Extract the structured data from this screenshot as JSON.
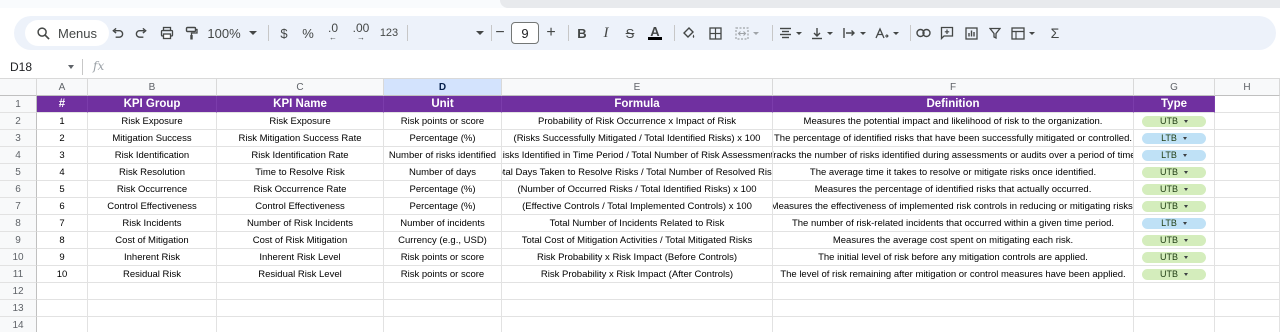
{
  "toolbar": {
    "menus_label": "Menus",
    "zoom": "100%",
    "currency": "$",
    "percent": "%",
    "dec_decrease": ".0",
    "dec_increase": ".00",
    "number_format": "123",
    "font_size": "9"
  },
  "formula_bar": {
    "cell_ref": "D18",
    "fx": "fx"
  },
  "sheet": {
    "columns": [
      "A",
      "B",
      "C",
      "D",
      "E",
      "F",
      "G",
      "H"
    ],
    "selected_column": "D",
    "row_numbers": [
      "1",
      "2",
      "3",
      "4",
      "5",
      "6",
      "7",
      "8",
      "9",
      "10",
      "11",
      "12",
      "13",
      "14"
    ],
    "header_row": [
      "#",
      "KPI Group",
      "KPI Name",
      "Unit",
      "Formula",
      "Definition",
      "Type"
    ],
    "rows": [
      [
        "1",
        "Risk Exposure",
        "Risk Exposure",
        "Risk points or score",
        "Probability of Risk Occurrence x Impact of Risk",
        "Measures the potential impact and likelihood of risk to the organization.",
        "UTB"
      ],
      [
        "2",
        "Mitigation Success",
        "Risk Mitigation Success Rate",
        "Percentage (%)",
        "(Risks Successfully Mitigated / Total Identified Risks) x 100",
        "The percentage of identified risks that have been successfully mitigated or controlled.",
        "LTB"
      ],
      [
        "3",
        "Risk Identification",
        "Risk Identification Rate",
        "Number of risks identified",
        "Risks Identified in Time Period / Total Number of Risk Assessments",
        "Tracks the number of risks identified during assessments or audits over a period of time.",
        "LTB"
      ],
      [
        "4",
        "Risk Resolution",
        "Time to Resolve Risk",
        "Number of days",
        "Total Days Taken to Resolve Risks / Total Number of Resolved Risks",
        "The average time it takes to resolve or mitigate risks once identified.",
        "UTB"
      ],
      [
        "5",
        "Risk Occurrence",
        "Risk Occurrence Rate",
        "Percentage (%)",
        "(Number of Occurred Risks / Total Identified Risks) x 100",
        "Measures the percentage of identified risks that actually occurred.",
        "UTB"
      ],
      [
        "6",
        "Control Effectiveness",
        "Control Effectiveness",
        "Percentage (%)",
        "(Effective Controls / Total Implemented Controls) x 100",
        "Measures the effectiveness of implemented risk controls in reducing or mitigating risks.",
        "UTB"
      ],
      [
        "7",
        "Risk Incidents",
        "Number of Risk Incidents",
        "Number of incidents",
        "Total Number of Incidents Related to Risk",
        "The number of risk-related incidents that occurred within a given time period.",
        "LTB"
      ],
      [
        "8",
        "Cost of Mitigation",
        "Cost of Risk Mitigation",
        "Currency (e.g., USD)",
        "Total Cost of Mitigation Activities / Total Mitigated Risks",
        "Measures the average cost spent on mitigating each risk.",
        "UTB"
      ],
      [
        "9",
        "Inherent Risk",
        "Inherent Risk Level",
        "Risk points or score",
        "Risk Probability x Risk Impact (Before Controls)",
        "The initial level of risk before any mitigation controls are applied.",
        "UTB"
      ],
      [
        "10",
        "Residual Risk",
        "Residual Risk Level",
        "Risk points or score",
        "Risk Probability x Risk Impact (After Controls)",
        "The level of risk remaining after mitigation or control measures have been applied.",
        "UTB"
      ]
    ],
    "type_colors": {
      "UTB": "#d4edbc",
      "LTB": "#bfe1f6"
    },
    "header_color": "#7030a0"
  }
}
